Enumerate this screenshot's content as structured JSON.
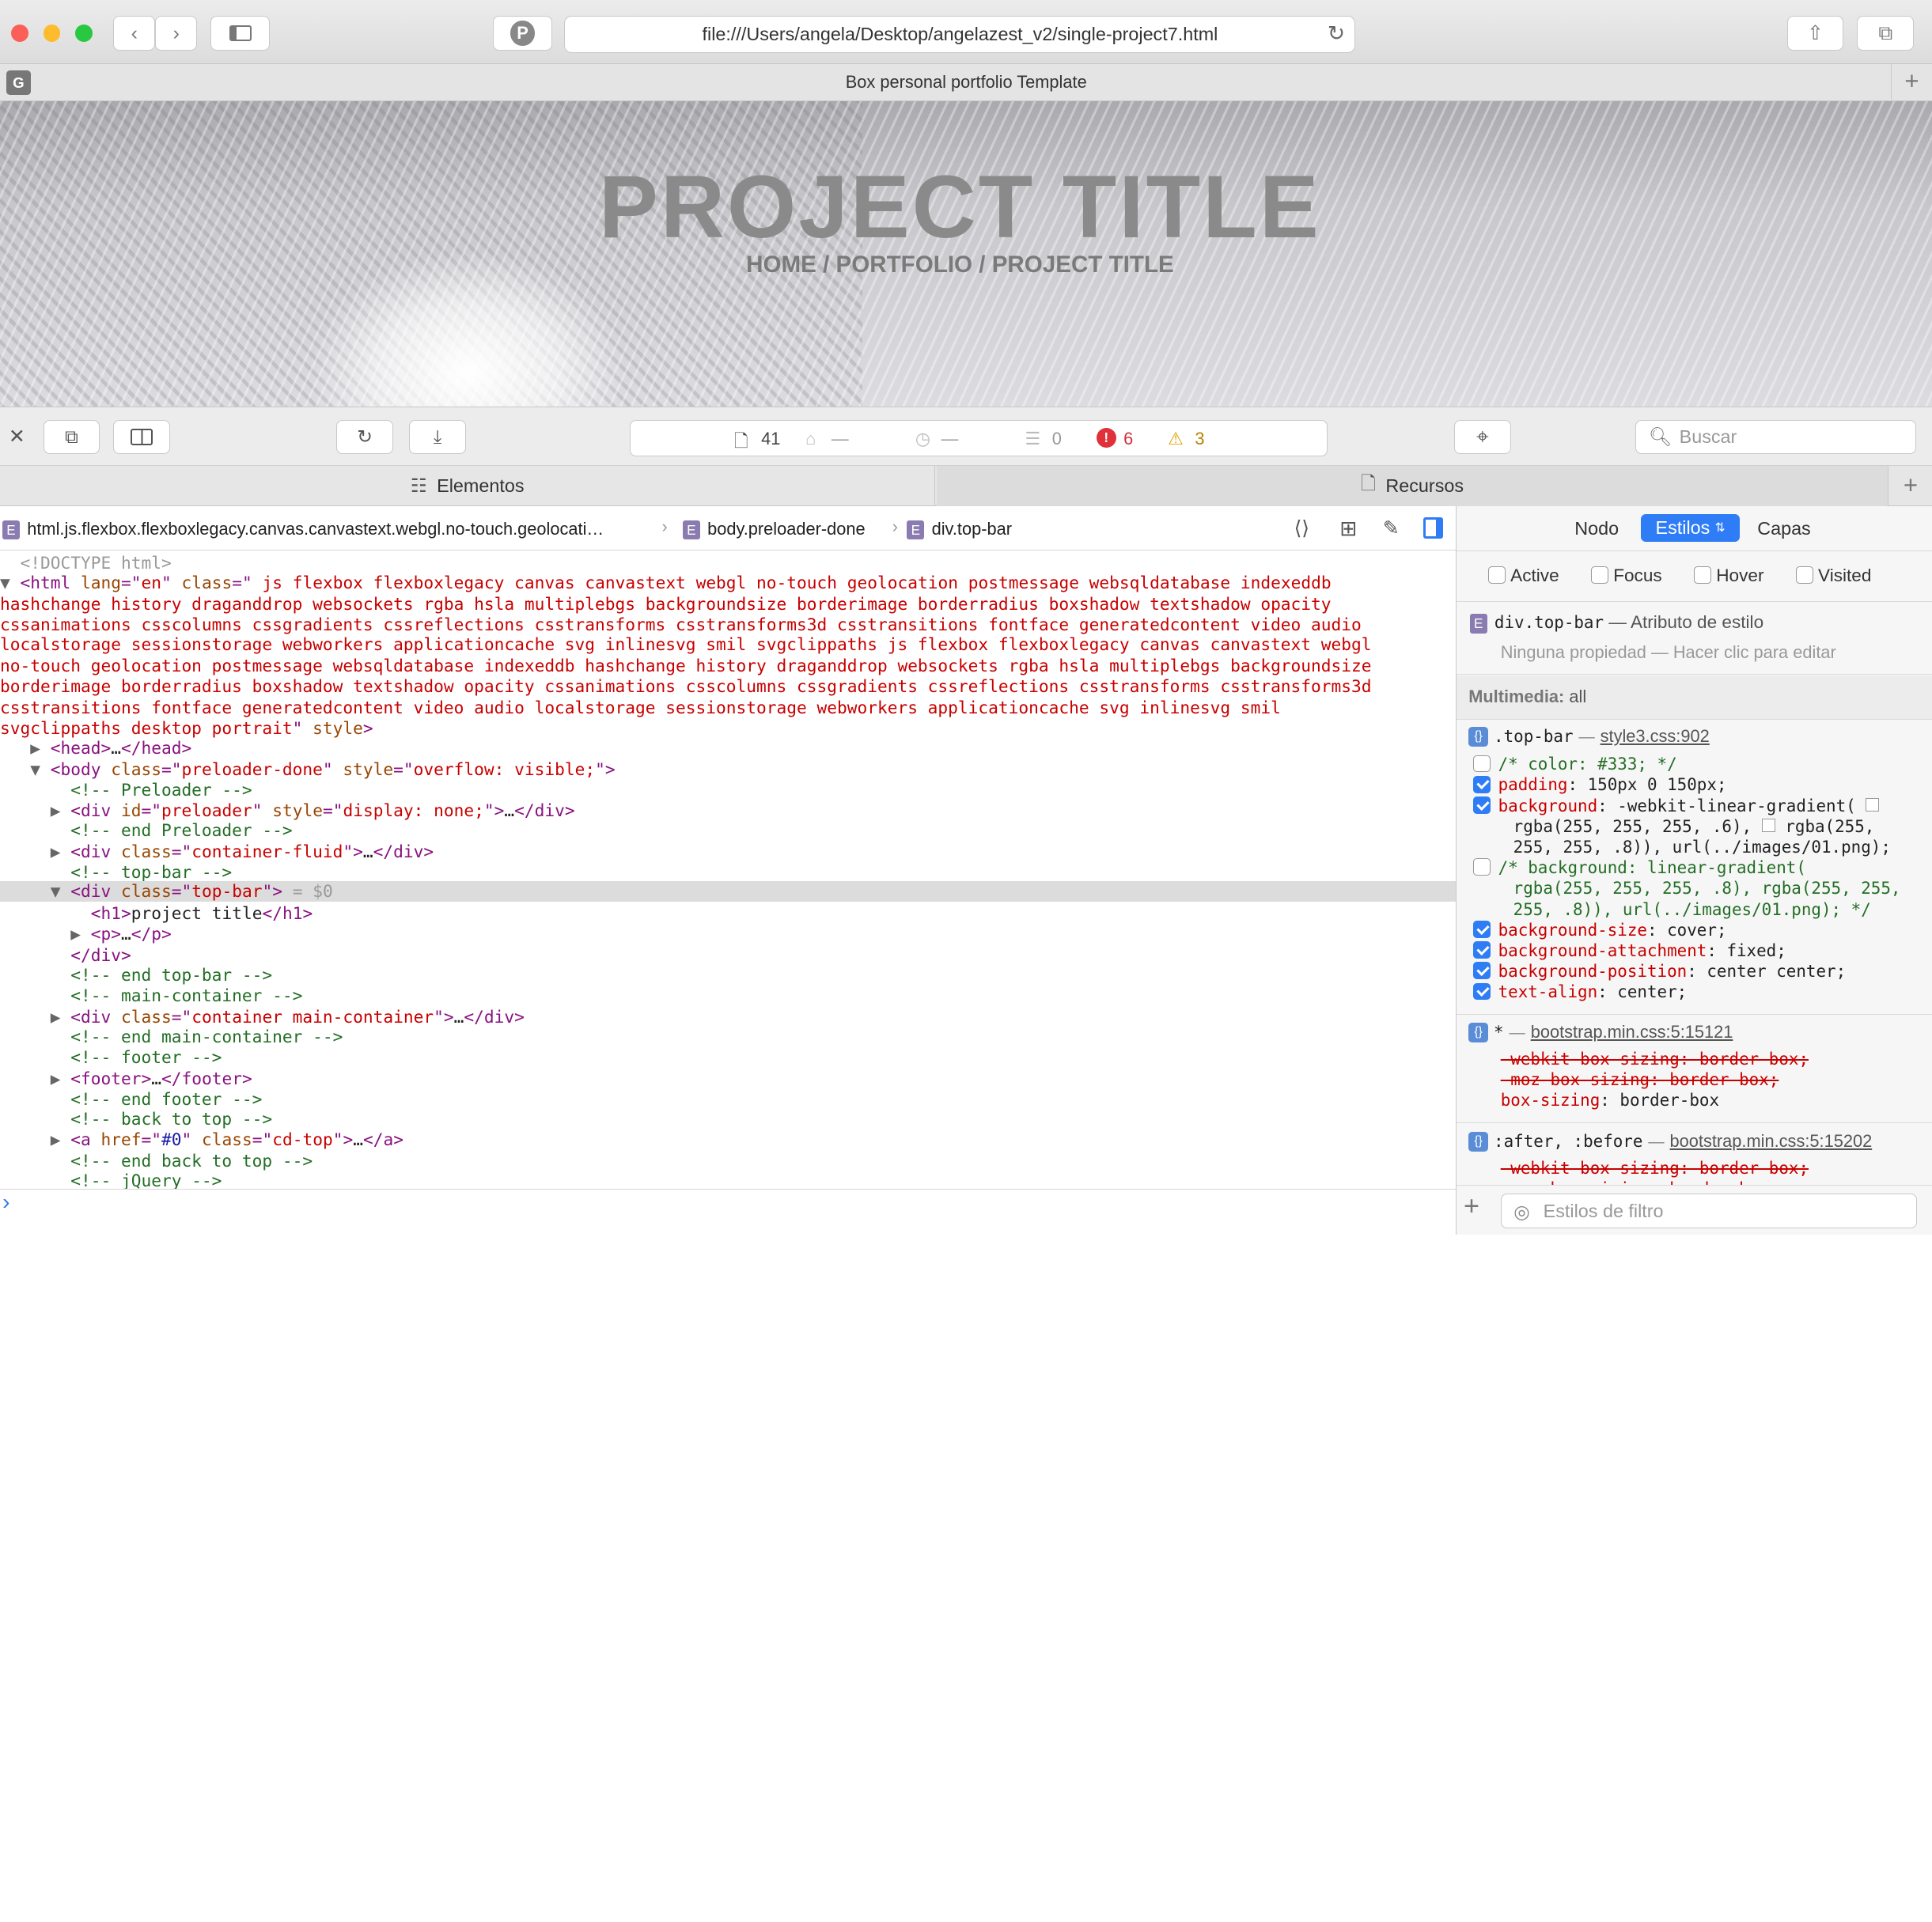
{
  "window": {
    "url": "file:///Users/angela/Desktop/angelazest_v2/single-project7.html",
    "tab_title": "Box personal portfolio Template",
    "tab_favicon": "G"
  },
  "page": {
    "hero_title": "PROJECT TITLE",
    "breadcrumb": "HOME / PORTFOLIO / PROJECT TITLE"
  },
  "devtools": {
    "resource_count": "41",
    "dash1": "—",
    "dash2": "—",
    "logs": "0",
    "errors": "6",
    "warnings": "3",
    "search_placeholder": "Buscar",
    "tab_elements": "Elementos",
    "tab_resources": "Recursos",
    "path": [
      "html.js.flexbox.flexboxlegacy.canvas.canvastext.webgl.no-touch.geolocati…",
      "body.preloader-done",
      "div.top-bar"
    ],
    "sidebar": {
      "tabs": [
        "Nodo",
        "Estilos",
        "Capas"
      ],
      "states": [
        "Active",
        "Focus",
        "Hover",
        "Visited"
      ],
      "selector": "div.top-bar",
      "selector_note": "— Atributo de estilo",
      "empty_note": "Ninguna propiedad — Hacer clic para editar",
      "media": "Multimedia:",
      "media_val": "all",
      "rule1": {
        "selector": ".top-bar",
        "source": "style3.css:902"
      },
      "rule2": {
        "selector": "*",
        "source": "bootstrap.min.css:5:15121"
      },
      "rule3": {
        "selector": ":after, :before",
        "source": "bootstrap.min.css:5:15202"
      },
      "filter_placeholder": "Estilos de filtro"
    }
  }
}
